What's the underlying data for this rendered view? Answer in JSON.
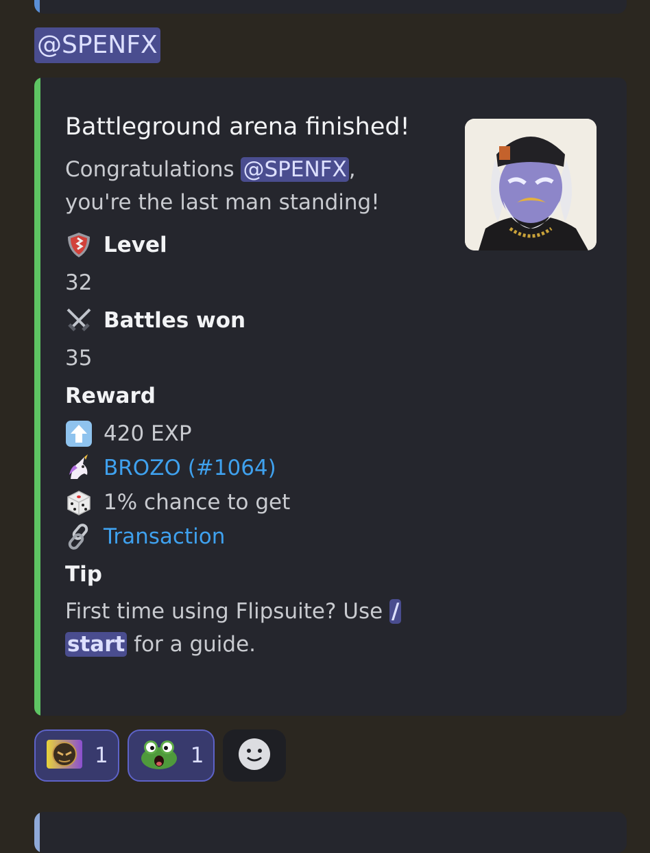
{
  "message": {
    "mention": "@SPENFX"
  },
  "embed": {
    "title": "Battleground arena finished!",
    "description_prefix": "Congratulations ",
    "description_mention": "@SPENFX",
    "description_suffix": ",",
    "description_line2": "you're the last man standing!",
    "fields": {
      "level_name": "Level",
      "level_value": "32",
      "battles_name": "Battles won",
      "battles_value": "35",
      "reward_name": "Reward",
      "reward_exp": "420 EXP",
      "reward_nft": "BROZO (#1064)",
      "reward_chance": "1% chance to get",
      "reward_transaction": "Transaction",
      "tip_name": "Tip",
      "tip_text": "First time using Flipsuite? Use ",
      "tip_command_1": "/",
      "tip_command_2": "start",
      "tip_suffix": " for a guide."
    },
    "icons": {
      "level": "shield-icon",
      "battles": "crossed-swords-icon",
      "exp": "up-arrow-icon",
      "nft": "unicorn-icon",
      "chance": "dice-icon",
      "transaction": "chain-link-icon"
    },
    "colors": {
      "accent": "#5ec463",
      "link": "#3fa1ee",
      "mention_bg": "#4a4d8f"
    }
  },
  "reactions": [
    {
      "emoji": "robot-face-emoji",
      "count": "1"
    },
    {
      "emoji": "frog-emoji",
      "count": "1"
    }
  ]
}
